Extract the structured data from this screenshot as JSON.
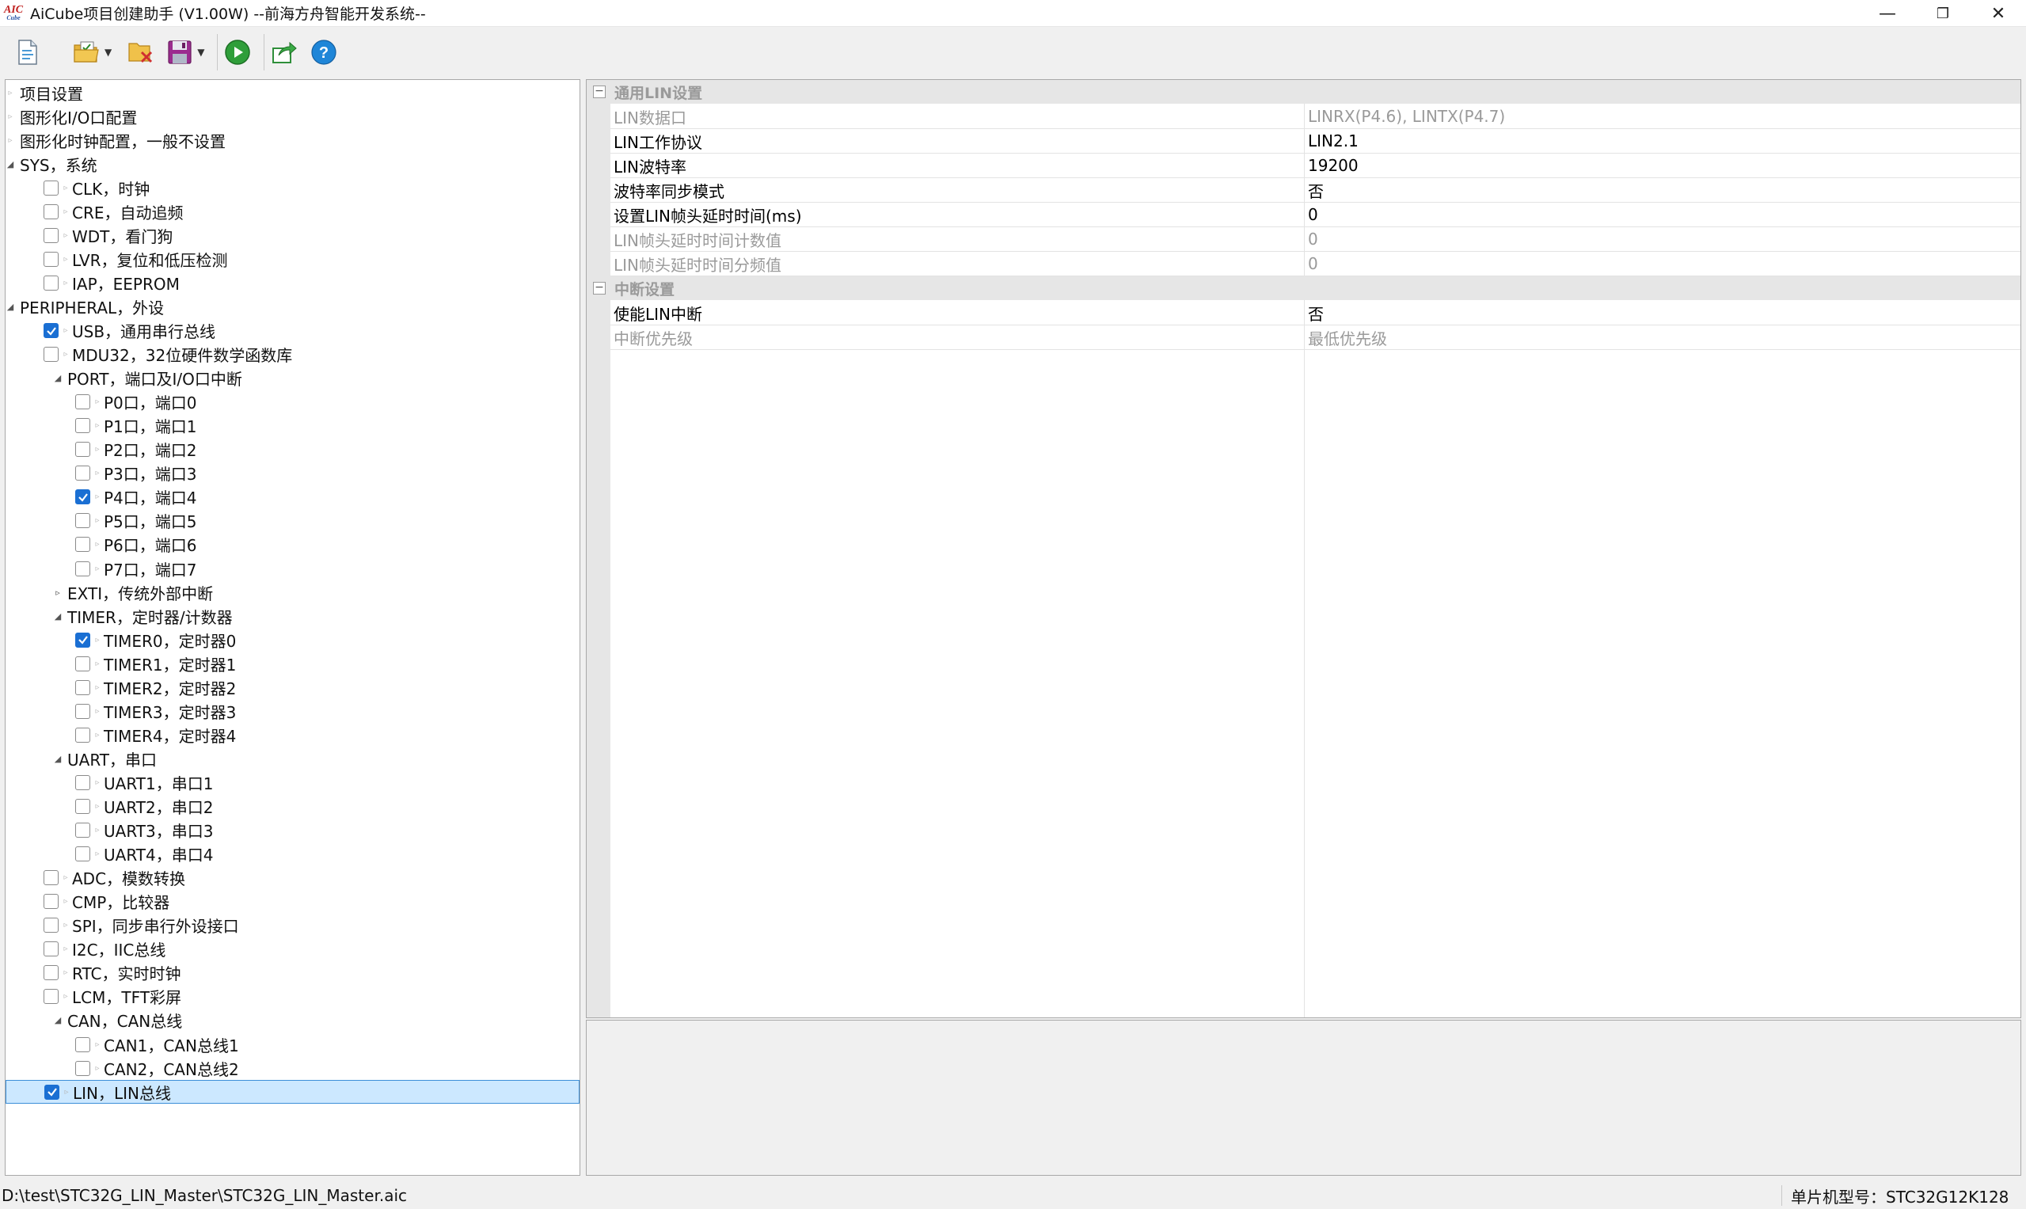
{
  "window": {
    "title": "AiCube项目创建助手 (V1.00W) --前海方舟智能开发系统--",
    "logo_top": "AIC",
    "logo_bottom": "Cube",
    "minimize": "—",
    "maximize": "❐",
    "close": "✕"
  },
  "toolbar": {
    "icons": [
      "new-file-icon",
      "open-folder-icon",
      "close-project-icon",
      "save-icon",
      "run-icon",
      "export-icon",
      "help-icon"
    ],
    "help_glyph": "?"
  },
  "tree": [
    {
      "label": "项目设置",
      "level": 0,
      "type": "leaf"
    },
    {
      "label": "图形化I/O口配置",
      "level": 0,
      "type": "leaf"
    },
    {
      "label": "图形化时钟配置，一般不设置",
      "level": 0,
      "type": "leaf"
    },
    {
      "label": "SYS，系统",
      "level": 0,
      "type": "expanded"
    },
    {
      "label": "CLK，时钟",
      "level": 1,
      "type": "check",
      "checked": false
    },
    {
      "label": "CRE，自动追频",
      "level": 1,
      "type": "check",
      "checked": false
    },
    {
      "label": "WDT，看门狗",
      "level": 1,
      "type": "check",
      "checked": false
    },
    {
      "label": "LVR，复位和低压检测",
      "level": 1,
      "type": "check",
      "checked": false
    },
    {
      "label": "IAP，EEPROM",
      "level": 1,
      "type": "check",
      "checked": false
    },
    {
      "label": "PERIPHERAL，外设",
      "level": 0,
      "type": "expanded"
    },
    {
      "label": "USB，通用串行总线",
      "level": 1,
      "type": "check",
      "checked": true
    },
    {
      "label": "MDU32，32位硬件数学函数库",
      "level": 1,
      "type": "check",
      "checked": false
    },
    {
      "label": "PORT，端口及I/O口中断",
      "level": 1,
      "type": "expanded"
    },
    {
      "label": "P0口，端口0",
      "level": 2,
      "type": "check",
      "checked": false
    },
    {
      "label": "P1口，端口1",
      "level": 2,
      "type": "check",
      "checked": false
    },
    {
      "label": "P2口，端口2",
      "level": 2,
      "type": "check",
      "checked": false
    },
    {
      "label": "P3口，端口3",
      "level": 2,
      "type": "check",
      "checked": false
    },
    {
      "label": "P4口，端口4",
      "level": 2,
      "type": "check",
      "checked": true
    },
    {
      "label": "P5口，端口5",
      "level": 2,
      "type": "check",
      "checked": false
    },
    {
      "label": "P6口，端口6",
      "level": 2,
      "type": "check",
      "checked": false
    },
    {
      "label": "P7口，端口7",
      "level": 2,
      "type": "check",
      "checked": false
    },
    {
      "label": "EXTI，传统外部中断",
      "level": 1,
      "type": "collapsed"
    },
    {
      "label": "TIMER，定时器/计数器",
      "level": 1,
      "type": "expanded"
    },
    {
      "label": "TIMER0，定时器0",
      "level": 2,
      "type": "check",
      "checked": true
    },
    {
      "label": "TIMER1，定时器1",
      "level": 2,
      "type": "check",
      "checked": false
    },
    {
      "label": "TIMER2，定时器2",
      "level": 2,
      "type": "check",
      "checked": false
    },
    {
      "label": "TIMER3，定时器3",
      "level": 2,
      "type": "check",
      "checked": false
    },
    {
      "label": "TIMER4，定时器4",
      "level": 2,
      "type": "check",
      "checked": false
    },
    {
      "label": "UART，串口",
      "level": 1,
      "type": "expanded"
    },
    {
      "label": "UART1，串口1",
      "level": 2,
      "type": "check",
      "checked": false
    },
    {
      "label": "UART2，串口2",
      "level": 2,
      "type": "check",
      "checked": false
    },
    {
      "label": "UART3，串口3",
      "level": 2,
      "type": "check",
      "checked": false
    },
    {
      "label": "UART4，串口4",
      "level": 2,
      "type": "check",
      "checked": false
    },
    {
      "label": "ADC，模数转换",
      "level": 1,
      "type": "check",
      "checked": false
    },
    {
      "label": "CMP，比较器",
      "level": 1,
      "type": "check",
      "checked": false
    },
    {
      "label": "SPI，同步串行外设接口",
      "level": 1,
      "type": "check",
      "checked": false
    },
    {
      "label": "I2C，IIC总线",
      "level": 1,
      "type": "check",
      "checked": false
    },
    {
      "label": "RTC，实时时钟",
      "level": 1,
      "type": "check",
      "checked": false
    },
    {
      "label": "LCM，TFT彩屏",
      "level": 1,
      "type": "check",
      "checked": false
    },
    {
      "label": "CAN，CAN总线",
      "level": 1,
      "type": "expanded"
    },
    {
      "label": "CAN1，CAN总线1",
      "level": 2,
      "type": "check",
      "checked": false
    },
    {
      "label": "CAN2，CAN总线2",
      "level": 2,
      "type": "check",
      "checked": false
    },
    {
      "label": "LIN，LIN总线",
      "level": 1,
      "type": "check",
      "checked": true,
      "selected": true
    }
  ],
  "property_grid": {
    "categories": [
      {
        "title": "通用LIN设置",
        "toggle": "−",
        "rows": [
          {
            "name": "LIN数据口",
            "value": "LINRX(P4.6), LINTX(P4.7)",
            "disabled": true
          },
          {
            "name": "LIN工作协议",
            "value": "LIN2.1",
            "disabled": false
          },
          {
            "name": "LIN波特率",
            "value": "19200",
            "disabled": false
          },
          {
            "name": "波特率同步模式",
            "value": "否",
            "disabled": false
          },
          {
            "name": "设置LIN帧头延时时间(ms)",
            "value": "0",
            "disabled": false
          },
          {
            "name": "LIN帧头延时时间计数值",
            "value": "0",
            "disabled": true
          },
          {
            "name": "LIN帧头延时时间分频值",
            "value": "0",
            "disabled": true
          }
        ]
      },
      {
        "title": "中断设置",
        "toggle": "−",
        "rows": [
          {
            "name": "使能LIN中断",
            "value": "否",
            "disabled": false
          },
          {
            "name": "中断优先级",
            "value": "最低优先级",
            "disabled": true
          }
        ]
      }
    ]
  },
  "status": {
    "path": "D:\\test\\STC32G_LIN_Master\\STC32G_LIN_Master.aic",
    "chip": "单片机型号：STC32G12K128"
  }
}
